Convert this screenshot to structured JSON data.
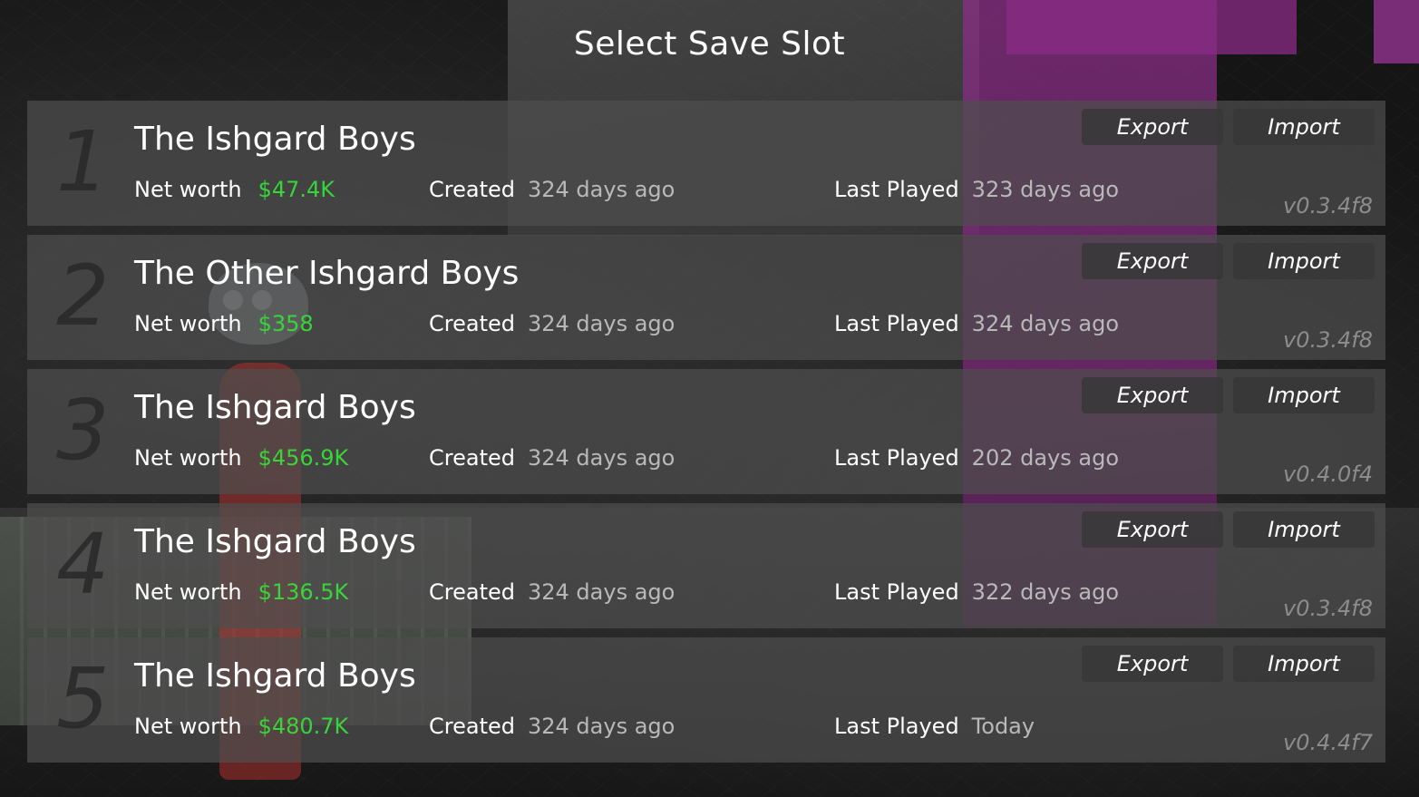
{
  "title": "Select Save Slot",
  "labels": {
    "net_worth": "Net worth",
    "created": "Created",
    "last_played": "Last Played",
    "export": "Export",
    "import": "Import"
  },
  "colors": {
    "money": "#39d43a",
    "accent_wall": "#8a2f86"
  },
  "slots": [
    {
      "number": "1",
      "name": "The Ishgard Boys",
      "net_worth": "$47.4K",
      "created": "324 days ago",
      "last_played": "323 days ago",
      "version": "v0.3.4f8"
    },
    {
      "number": "2",
      "name": "The Other Ishgard Boys",
      "net_worth": "$358",
      "created": "324 days ago",
      "last_played": "324 days ago",
      "version": "v0.3.4f8"
    },
    {
      "number": "3",
      "name": "The Ishgard Boys",
      "net_worth": "$456.9K",
      "created": "324 days ago",
      "last_played": "202 days ago",
      "version": "v0.4.0f4"
    },
    {
      "number": "4",
      "name": "The Ishgard Boys",
      "net_worth": "$136.5K",
      "created": "324 days ago",
      "last_played": "322 days ago",
      "version": "v0.3.4f8"
    },
    {
      "number": "5",
      "name": "The Ishgard Boys",
      "net_worth": "$480.7K",
      "created": "324 days ago",
      "last_played": "Today",
      "version": "v0.4.4f7"
    }
  ]
}
